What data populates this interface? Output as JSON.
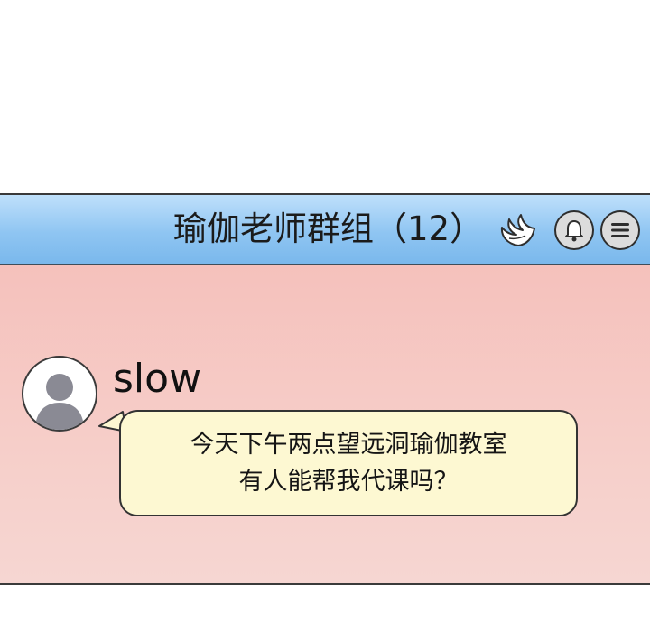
{
  "header": {
    "title": "瑜伽老师群组（12）",
    "wing_icon": "angel-wing-icon",
    "bell_icon": "bell-icon",
    "menu_icon": "hamburger-menu-icon"
  },
  "message": {
    "sender": "slow",
    "avatar_icon": "default-user-avatar-icon",
    "lines": [
      "今天下午两点望远洞瑜伽教室",
      "有人能帮我代课吗？"
    ]
  },
  "colors": {
    "header_bg": "#8fc5f2",
    "chat_bg": "#f6cdc8",
    "bubble_bg": "#fdf8d2"
  }
}
